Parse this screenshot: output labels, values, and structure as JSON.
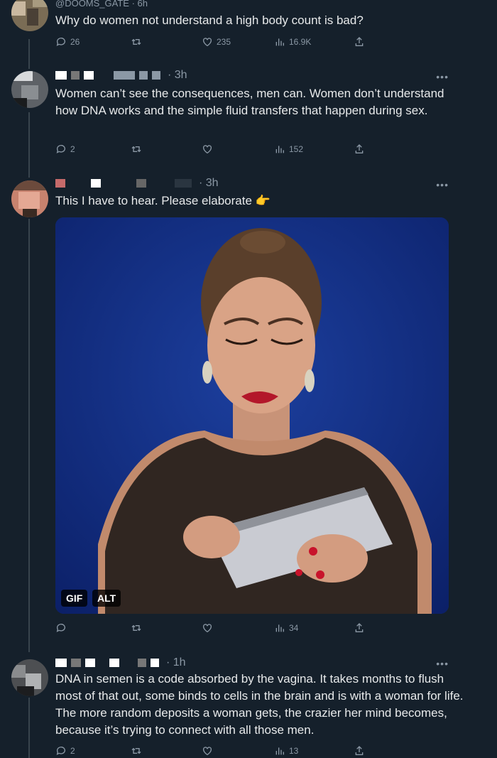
{
  "tweets": [
    {
      "handle": "@DOOMS_GATE · 6h",
      "text": "Why do women not understand a high body count is bad?",
      "replies": "26",
      "reposts": "",
      "likes": "235",
      "views": "16.9K"
    },
    {
      "time": "· 3h",
      "text": "Women can’t see the consequences, men can. Women don’t understand how DNA works and the simple fluid transfers that happen during sex.",
      "replies": "2",
      "reposts": "",
      "likes": "",
      "views": "152"
    },
    {
      "time": "· 3h",
      "text": "This I have to hear. Please elaborate 👉",
      "media": {
        "gif_label": "GIF",
        "alt_label": "ALT"
      },
      "replies": "",
      "reposts": "",
      "likes": "",
      "views": "34"
    },
    {
      "time": "· 1h",
      "text": "DNA in semen is a code absorbed by the vagina. It takes months to flush most of that out, some binds to cells in the brain and is with a woman for life. The more random deposits a woman gets, the crazier her mind becomes, because it’s trying to connect with all those men.",
      "replies": "2",
      "reposts": "",
      "likes": "",
      "views": "13"
    }
  ],
  "icons": {
    "reply": "reply-icon",
    "repost": "repost-icon",
    "like": "heart-icon",
    "views": "views-icon",
    "share": "share-icon",
    "more": "more-icon"
  },
  "colors": {
    "background": "#15202b",
    "text": "#e7e9ea",
    "muted": "#8b98a5",
    "media_bg": "#0f2a80"
  },
  "more_label": "•••"
}
